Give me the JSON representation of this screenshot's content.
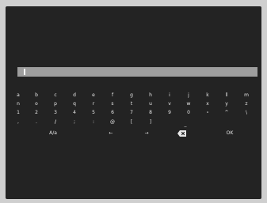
{
  "input": {
    "value": ""
  },
  "keyboard": {
    "row1": [
      "a",
      "b",
      "c",
      "d",
      "e",
      "f",
      "g",
      "h",
      "i",
      "j",
      "k",
      "l",
      "m"
    ],
    "row2": [
      "n",
      "o",
      "p",
      "q",
      "r",
      "s",
      "t",
      "u",
      "v",
      "w",
      "x",
      "y",
      "z"
    ],
    "row3": [
      "1",
      "2",
      "3",
      "4",
      "5",
      "6",
      "7",
      "8",
      "9",
      "0",
      "-",
      "^",
      "\\"
    ],
    "row4": [
      ",",
      ".",
      "/",
      ";",
      ":",
      "@",
      "[",
      "]",
      "_"
    ],
    "controls": {
      "case_toggle": "A/a",
      "left_arrow": "←",
      "right_arrow": "→",
      "ok": "OK"
    }
  },
  "icons": {
    "backspace": "backspace-icon"
  }
}
